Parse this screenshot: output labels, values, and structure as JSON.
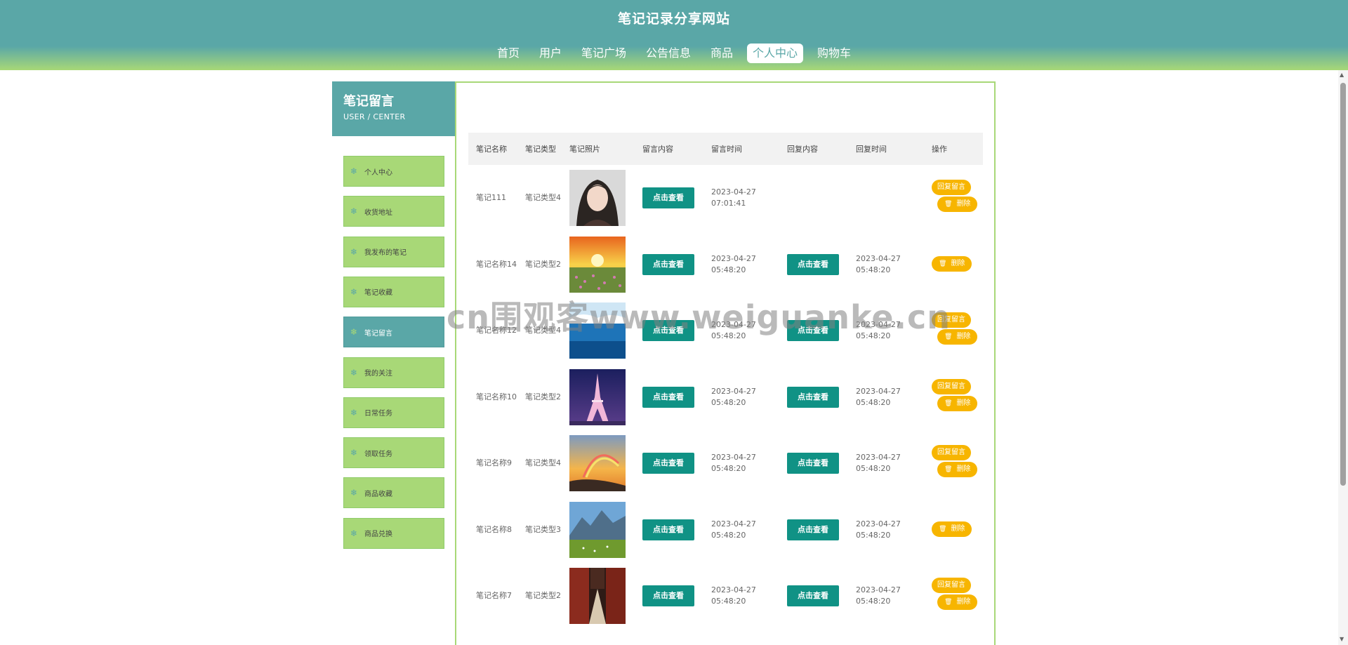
{
  "header": {
    "site_title": "笔记记录分享网站",
    "nav": [
      "首页",
      "用户",
      "笔记广场",
      "公告信息",
      "商品",
      "个人中心",
      "购物车"
    ],
    "active_nav": 5
  },
  "sidebar": {
    "title": "笔记留言",
    "subtitle": "USER / CENTER",
    "items": [
      "个人中心",
      "收货地址",
      "我发布的笔记",
      "笔记收藏",
      "笔记留言",
      "我的关注",
      "日常任务",
      "领取任务",
      "商品收藏",
      "商品兑换"
    ],
    "active_index": 4,
    "item_icon": "snowflake-icon"
  },
  "table": {
    "headers": [
      "笔记名称",
      "笔记类型",
      "笔记照片",
      "留言内容",
      "留言时间",
      "回复内容",
      "回复时间",
      "操作"
    ],
    "view_label": "点击查看",
    "reply_label": "回复留言",
    "delete_label": "删除",
    "rows": [
      {
        "name": "笔记111",
        "type": "笔记类型4",
        "photo": "portrait-girl",
        "msg_time": "2023-04-27 07:01:41",
        "has_reply": false,
        "reply_time": "",
        "can_reply": true
      },
      {
        "name": "笔记名称14",
        "type": "笔记类型2",
        "photo": "sunset-meadow",
        "msg_time": "2023-04-27 05:48:20",
        "has_reply": true,
        "reply_time": "2023-04-27 05:48:20",
        "can_reply": false
      },
      {
        "name": "笔记名称12",
        "type": "笔记类型4",
        "photo": "blue-sea",
        "msg_time": "2023-04-27 05:48:20",
        "has_reply": true,
        "reply_time": "2023-04-27 05:48:20",
        "can_reply": true
      },
      {
        "name": "笔记名称10",
        "type": "笔记类型2",
        "photo": "eiffel-tower",
        "msg_time": "2023-04-27 05:48:20",
        "has_reply": true,
        "reply_time": "2023-04-27 05:48:20",
        "can_reply": true
      },
      {
        "name": "笔记名称9",
        "type": "笔记类型4",
        "photo": "rainbow-coast",
        "msg_time": "2023-04-27 05:48:20",
        "has_reply": true,
        "reply_time": "2023-04-27 05:48:20",
        "can_reply": true
      },
      {
        "name": "笔记名称8",
        "type": "笔记类型3",
        "photo": "mountain-field",
        "msg_time": "2023-04-27 05:48:20",
        "has_reply": true,
        "reply_time": "2023-04-27 05:48:20",
        "can_reply": false
      },
      {
        "name": "笔记名称7",
        "type": "笔记类型2",
        "photo": "corridor",
        "msg_time": "2023-04-27 05:48:20",
        "has_reply": true,
        "reply_time": "2023-04-27 05:48:20",
        "can_reply": true
      }
    ]
  },
  "watermark": "cn围观客www.weiguanke.cn",
  "colors": {
    "teal": "#5aa7a7",
    "green": "#a8d877",
    "button": "#109285",
    "orange": "#f7b500"
  }
}
